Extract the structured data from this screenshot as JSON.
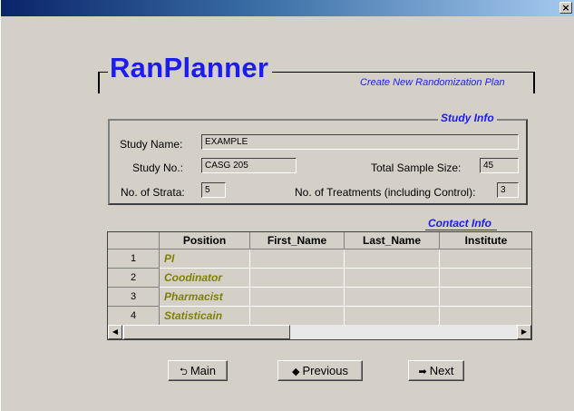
{
  "window": {
    "close_glyph": "×"
  },
  "brand": {
    "title": "RanPlanner",
    "subtitle": "Create New Randomization Plan"
  },
  "study_info": {
    "legend": "Study Info",
    "study_name_label": "Study Name:",
    "study_name_value": "EXAMPLE",
    "study_no_label": "Study No.:",
    "study_no_value": "CASG 205",
    "total_sample_label": "Total Sample Size:",
    "total_sample_value": "45",
    "strata_label": "No. of Strata:",
    "strata_value": "5",
    "treatments_label": "No. of Treatments (including Control):",
    "treatments_value": "3"
  },
  "contact_info": {
    "legend": "Contact Info",
    "columns": [
      "Position",
      "First_Name",
      "Last_Name",
      "Institute"
    ],
    "rows": [
      {
        "num": "1",
        "position": "PI"
      },
      {
        "num": "2",
        "position": "Coodinator"
      },
      {
        "num": "3",
        "position": "Pharmacist"
      },
      {
        "num": "4",
        "position": "Statisticain"
      }
    ],
    "scroll_left_icon": "◀",
    "scroll_right_icon": "▶"
  },
  "buttons": {
    "main": {
      "icon": "return-arrow-icon",
      "glyph": "⮌",
      "label": "Main"
    },
    "previous": {
      "icon": "left-arrow-icon",
      "glyph": "◆",
      "label": "Previous"
    },
    "next": {
      "icon": "right-arrow-icon",
      "glyph": "➡",
      "label": "Next"
    }
  }
}
